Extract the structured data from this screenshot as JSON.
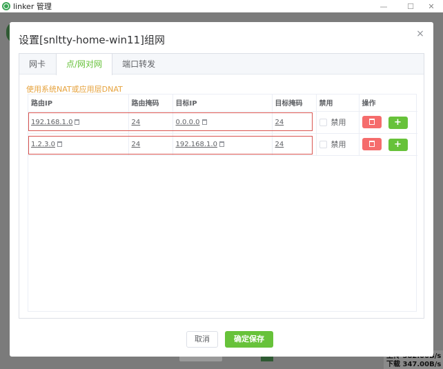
{
  "window": {
    "title": "linker 管理",
    "min_glyph": "—",
    "max_glyph": "☐",
    "close_glyph": "✕"
  },
  "background": {
    "speed_up": "上传 382.00B/s",
    "speed_down": "下载 347.00B/s"
  },
  "dialog": {
    "title": "设置[snltty-home-win11]组网",
    "close_glyph": "×",
    "tabs": [
      {
        "label": "网卡",
        "active": false
      },
      {
        "label": "点/网对网",
        "active": true
      },
      {
        "label": "端口转发",
        "active": false
      }
    ],
    "nat_note": "使用系统NAT或应用层DNAT",
    "table": {
      "headers": [
        "路由IP",
        "路由掩码",
        "目标IP",
        "目标掩码",
        "禁用",
        "操作"
      ],
      "rows": [
        {
          "route_ip": "192.168.1.0",
          "route_mask": "24",
          "target_ip": "0.0.0.0",
          "target_mask": "24",
          "disable_label": "禁用",
          "disabled": false
        },
        {
          "route_ip": "1.2.3.0",
          "route_mask": "24",
          "target_ip": "192.168.1.0",
          "target_mask": "24",
          "disable_label": "禁用",
          "disabled": false
        }
      ]
    },
    "buttons": {
      "cancel": "取消",
      "save": "确定保存",
      "add_glyph": "+"
    }
  },
  "colors": {
    "accent_green": "#67c23a",
    "danger_red": "#f56c6c",
    "warning_orange": "#e6a23c",
    "highlight_border": "#d9534f"
  }
}
